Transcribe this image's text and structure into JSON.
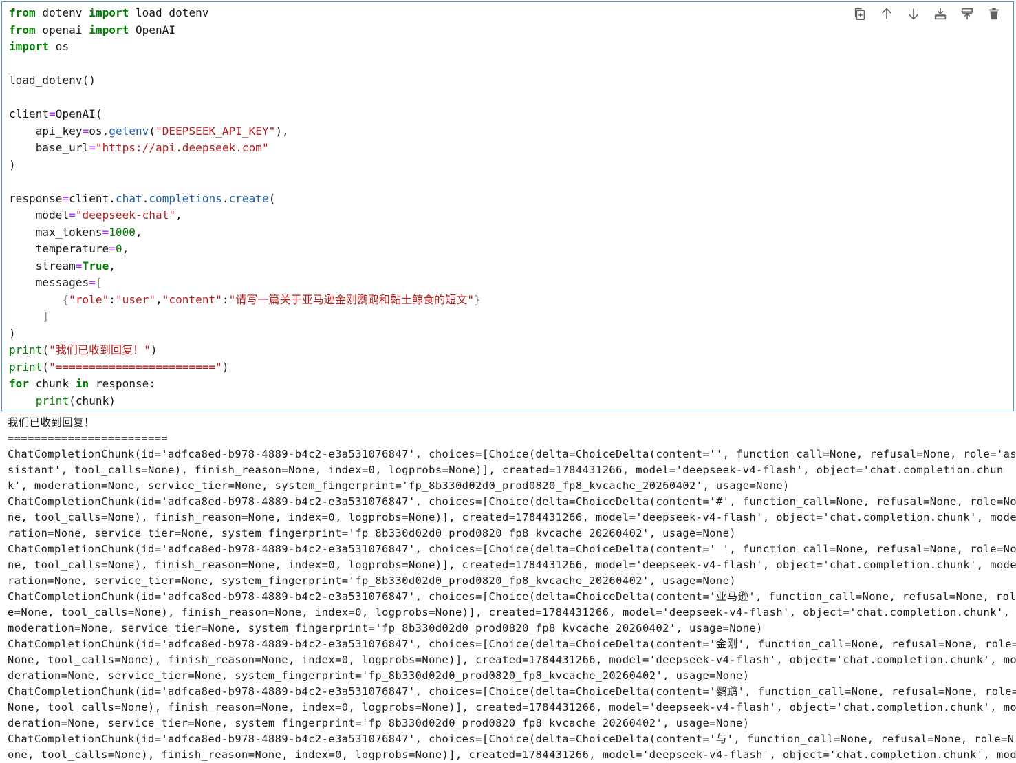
{
  "toolbar": {
    "buttons": [
      {
        "name": "duplicate-cell-button",
        "icon": "copy-icon"
      },
      {
        "name": "move-up-button",
        "icon": "arrow-up-icon"
      },
      {
        "name": "move-down-button",
        "icon": "arrow-down-icon"
      },
      {
        "name": "insert-above-button",
        "icon": "insert-above-icon"
      },
      {
        "name": "insert-below-button",
        "icon": "insert-below-icon"
      },
      {
        "name": "delete-cell-button",
        "icon": "trash-icon"
      }
    ]
  },
  "code": {
    "l1": {
      "kw1": "from",
      "mod": " dotenv ",
      "kw2": "import",
      "name": " load_dotenv"
    },
    "l2": {
      "kw1": "from",
      "mod": " openai ",
      "kw2": "import",
      "name": " OpenAI"
    },
    "l3": {
      "kw1": "import",
      "name": " os"
    },
    "l5": "load_dotenv()",
    "l7": {
      "var": "client",
      "eq": "=",
      "call": "OpenAI("
    },
    "l8": {
      "indent": "    ",
      "key": "api_key",
      "eq": "=",
      "obj": "os",
      "dot": ".",
      "fn": "getenv",
      "open": "(",
      "str": "\"DEEPSEEK_API_KEY\"",
      "close": "),"
    },
    "l9": {
      "indent": "    ",
      "key": "base_url",
      "eq": "=",
      "str": "\"https://api.deepseek.com\""
    },
    "l10": ")",
    "l12": {
      "var": "response",
      "eq": "=",
      "obj": "client",
      "d1": ".",
      "a1": "chat",
      "d2": ".",
      "a2": "completions",
      "d3": ".",
      "a3": "create",
      "open": "("
    },
    "l13": {
      "indent": "    ",
      "key": "model",
      "eq": "=",
      "str": "\"deepseek-chat\"",
      "tail": ","
    },
    "l14": {
      "indent": "    ",
      "key": "max_tokens",
      "eq": "=",
      "num": "1000",
      "tail": ","
    },
    "l15": {
      "indent": "    ",
      "key": "temperature",
      "eq": "=",
      "num": "0",
      "tail": ","
    },
    "l16": {
      "indent": "    ",
      "key": "stream",
      "eq": "=",
      "kw": "True",
      "tail": ","
    },
    "l17": {
      "indent": "    ",
      "key": "messages",
      "eq": "=",
      "br": "["
    },
    "l18": {
      "indent": "        ",
      "br1": "{",
      "s1": "\"role\"",
      "c1": ":",
      "s2": "\"user\"",
      "comma": ",",
      "s3": "\"content\"",
      "c2": ":",
      "s4": "\"请写一篇关于亚马逊金刚鹦鹉和黏土鲸食的短文\"",
      "br2": "}"
    },
    "l19": {
      "indent": "     ",
      "br": "]"
    },
    "l20": ")",
    "l21": {
      "fn": "print",
      "open": "(",
      "str": "\"我们已收到回复！\"",
      "close": ")"
    },
    "l22": {
      "fn": "print",
      "open": "(",
      "str": "\"========================\"",
      "close": ")"
    },
    "l23": {
      "kw1": "for",
      "v": " chunk ",
      "kw2": "in",
      "rest": " response:"
    },
    "l24": {
      "indent": "    ",
      "fn": "print",
      "rest": "(chunk)"
    }
  },
  "output": {
    "lines": [
      "我们已收到回复！",
      "========================",
      "ChatCompletionChunk(id='adfca8ed-b978-4889-b4c2-e3a531076847', choices=[Choice(delta=ChoiceDelta(content='', function_call=None, refusal=None, role='as",
      "sistant', tool_calls=None), finish_reason=None, index=0, logprobs=None)], created=1784431266, model='deepseek-v4-flash', object='chat.completion.chun",
      "k', moderation=None, service_tier=None, system_fingerprint='fp_8b330d02d0_prod0820_fp8_kvcache_20260402', usage=None)",
      "ChatCompletionChunk(id='adfca8ed-b978-4889-b4c2-e3a531076847', choices=[Choice(delta=ChoiceDelta(content='#', function_call=None, refusal=None, role=No",
      "ne, tool_calls=None), finish_reason=None, index=0, logprobs=None)], created=1784431266, model='deepseek-v4-flash', object='chat.completion.chunk', mode",
      "ration=None, service_tier=None, system_fingerprint='fp_8b330d02d0_prod0820_fp8_kvcache_20260402', usage=None)",
      "ChatCompletionChunk(id='adfca8ed-b978-4889-b4c2-e3a531076847', choices=[Choice(delta=ChoiceDelta(content=' ', function_call=None, refusal=None, role=No",
      "ne, tool_calls=None), finish_reason=None, index=0, logprobs=None)], created=1784431266, model='deepseek-v4-flash', object='chat.completion.chunk', mode",
      "ration=None, service_tier=None, system_fingerprint='fp_8b330d02d0_prod0820_fp8_kvcache_20260402', usage=None)",
      "ChatCompletionChunk(id='adfca8ed-b978-4889-b4c2-e3a531076847', choices=[Choice(delta=ChoiceDelta(content='亚马逊', function_call=None, refusal=None, rol",
      "e=None, tool_calls=None), finish_reason=None, index=0, logprobs=None)], created=1784431266, model='deepseek-v4-flash', object='chat.completion.chunk',",
      "moderation=None, service_tier=None, system_fingerprint='fp_8b330d02d0_prod0820_fp8_kvcache_20260402', usage=None)",
      "ChatCompletionChunk(id='adfca8ed-b978-4889-b4c2-e3a531076847', choices=[Choice(delta=ChoiceDelta(content='金刚', function_call=None, refusal=None, role=",
      "None, tool_calls=None), finish_reason=None, index=0, logprobs=None)], created=1784431266, model='deepseek-v4-flash', object='chat.completion.chunk', mo",
      "deration=None, service_tier=None, system_fingerprint='fp_8b330d02d0_prod0820_fp8_kvcache_20260402', usage=None)",
      "ChatCompletionChunk(id='adfca8ed-b978-4889-b4c2-e3a531076847', choices=[Choice(delta=ChoiceDelta(content='鹦鹉', function_call=None, refusal=None, role=",
      "None, tool_calls=None), finish_reason=None, index=0, logprobs=None)], created=1784431266, model='deepseek-v4-flash', object='chat.completion.chunk', mo",
      "deration=None, service_tier=None, system_fingerprint='fp_8b330d02d0_prod0820_fp8_kvcache_20260402', usage=None)",
      "ChatCompletionChunk(id='adfca8ed-b978-4889-b4c2-e3a531076847', choices=[Choice(delta=ChoiceDelta(content='与', function_call=None, refusal=None, role=N",
      "one, tool_calls=None), finish_reason=None, index=0, logprobs=None)], created=1784431266, model='deepseek-v4-flash', object='chat.completion.chunk', mod"
    ]
  }
}
